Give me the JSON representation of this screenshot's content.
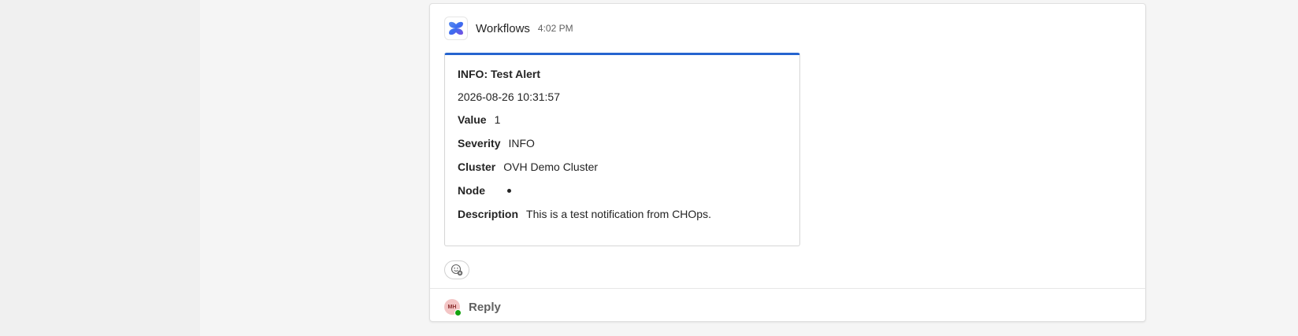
{
  "message": {
    "sender": "Workflows",
    "time": "4:02 PM",
    "icon": "workflows-logo-icon"
  },
  "card": {
    "title": "INFO: Test Alert",
    "datetime": "2026-08-26 10:31:57",
    "accent_color": "#2564cf",
    "facts": [
      {
        "key": "Value",
        "value": "1"
      },
      {
        "key": "Severity",
        "value": "INFO"
      },
      {
        "key": "Cluster",
        "value": "OVH Demo Cluster"
      },
      {
        "key": "Node",
        "value": ""
      },
      {
        "key": "Description",
        "value": "This is a test notification from CHOps."
      }
    ]
  },
  "reaction": {
    "icon": "add-reaction-icon"
  },
  "reply": {
    "avatar_initials": "MH",
    "label": "Reply",
    "presence": "available"
  }
}
